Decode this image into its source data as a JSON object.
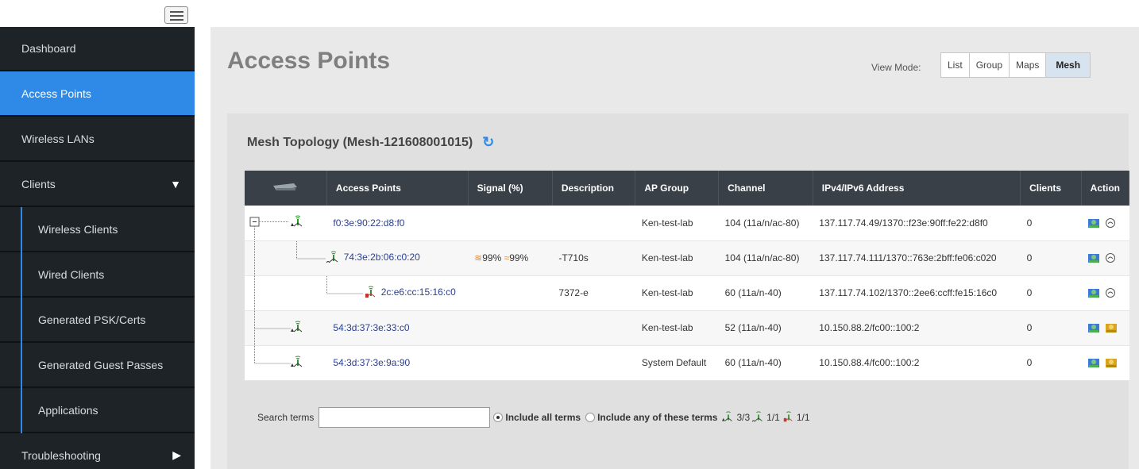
{
  "sidebar": {
    "items": [
      {
        "label": "Dashboard"
      },
      {
        "label": "Access Points"
      },
      {
        "label": "Wireless LANs"
      },
      {
        "label": "Clients"
      },
      {
        "label": "Wireless Clients"
      },
      {
        "label": "Wired Clients"
      },
      {
        "label": "Generated PSK/Certs"
      },
      {
        "label": "Generated Guest Passes"
      },
      {
        "label": "Applications"
      },
      {
        "label": "Troubleshooting"
      }
    ]
  },
  "page": {
    "title": "Access Points",
    "view_mode_label": "View Mode:",
    "view_modes": [
      "List",
      "Group",
      "Maps",
      "Mesh"
    ],
    "active_view_mode": "Mesh"
  },
  "panel": {
    "title": "Mesh Topology (Mesh-121608001015)"
  },
  "table": {
    "headers": [
      "Access Points",
      "Signal (%)",
      "Description",
      "AP Group",
      "Channel",
      "IPv4/IPv6 Address",
      "Clients",
      "Action"
    ],
    "rows": [
      {
        "mac": "f0:3e:90:22:d8:f0",
        "signal": "",
        "description": "",
        "group": "Ken-test-lab",
        "channel": "104 (11a/n/ac-80)",
        "ip": "137.117.74.49/1370::f23e:90ff:fe22:d8f0",
        "clients": "0"
      },
      {
        "mac": "74:3e:2b:06:c0:20",
        "signal": "99%",
        "signal2": "99%",
        "description": "-T710s",
        "group": "Ken-test-lab",
        "channel": "104 (11a/n/ac-80)",
        "ip": "137.117.74.111/1370::763e:2bff:fe06:c020",
        "clients": "0"
      },
      {
        "mac": "2c:e6:cc:15:16:c0",
        "signal": "",
        "description": "7372-e",
        "group": "Ken-test-lab",
        "channel": "60 (11a/n-40)",
        "ip": "137.117.74.102/1370::2ee6:ccff:fe15:16c0",
        "clients": "0"
      },
      {
        "mac": "54:3d:37:3e:33:c0",
        "signal": "",
        "description": "",
        "group": "Ken-test-lab",
        "channel": "52 (11a/n-40)",
        "ip": "10.150.88.2/fc00::100:2",
        "clients": "0"
      },
      {
        "mac": "54:3d:37:3e:9a:90",
        "signal": "",
        "description": "",
        "group": "System Default",
        "channel": "60 (11a/n-40)",
        "ip": "10.150.88.4/fc00::100:2",
        "clients": "0"
      }
    ]
  },
  "search": {
    "label": "Search terms",
    "value": "",
    "opt_all": "Include all terms",
    "opt_any": "Include any of these terms",
    "count_root": "3/3",
    "count_mesh": "1/1",
    "count_down": "1/1"
  },
  "colors": {
    "sidebar_bg": "#1e2328",
    "accent": "#2e8ae6",
    "table_header": "#3a4047"
  }
}
